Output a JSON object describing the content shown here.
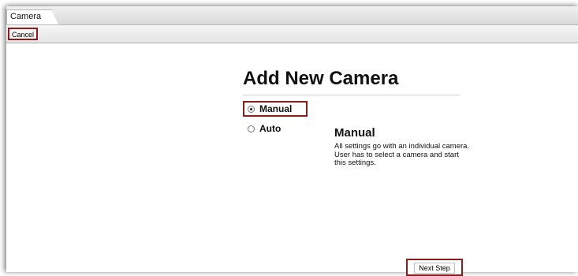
{
  "tab": {
    "label": "Camera"
  },
  "toolbar": {
    "cancel_label": "Cancel"
  },
  "main": {
    "title": "Add New Camera",
    "options": [
      {
        "label": "Manual",
        "selected": true
      },
      {
        "label": "Auto",
        "selected": false
      }
    ],
    "description": {
      "title": "Manual",
      "text": "All settings go with an individual camera. User has to select a camera and start this settings."
    },
    "next_label": "Next Step"
  },
  "colors": {
    "highlight_border": "#8a1c1c",
    "toolbar_bg": "#e4e4e4"
  }
}
